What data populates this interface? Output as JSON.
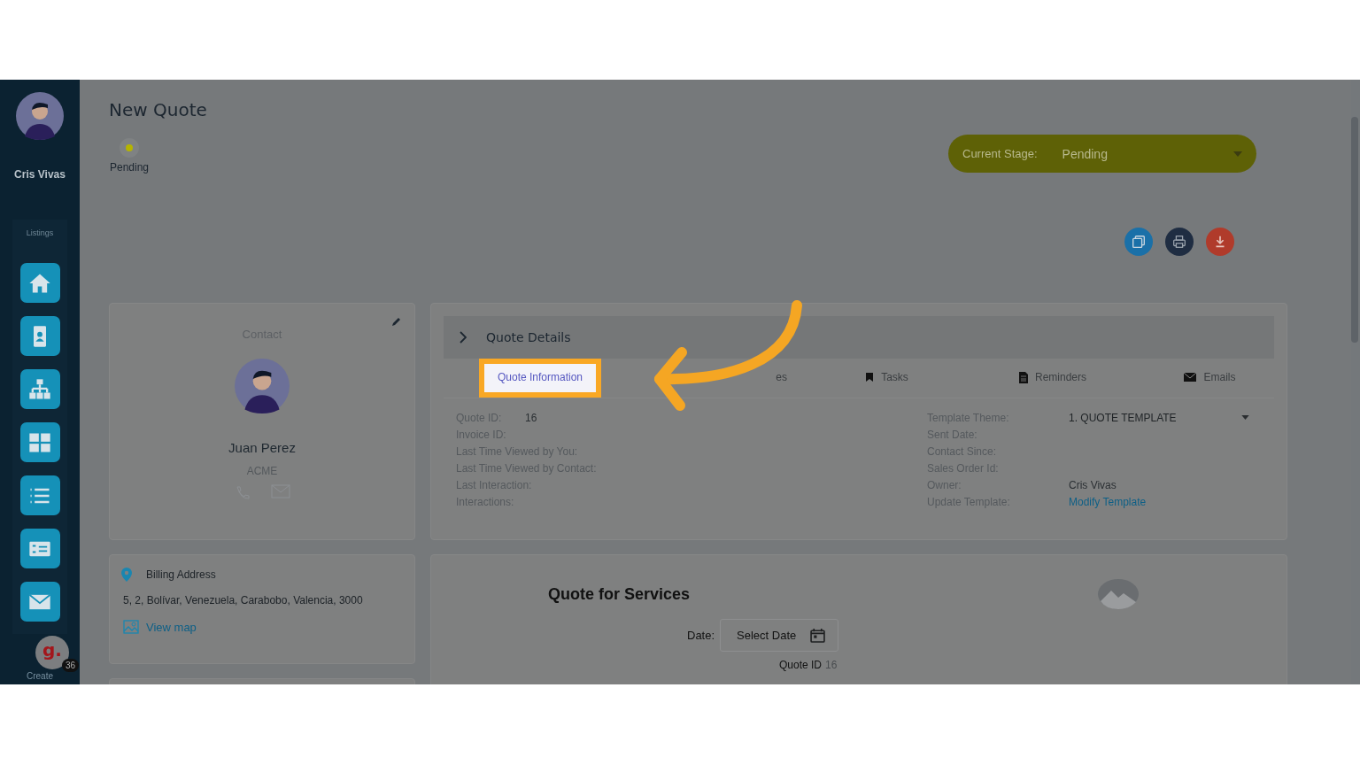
{
  "sidebar": {
    "user_name": "Cris Vivas",
    "section_label": "Listings",
    "items": [
      {
        "kind": "home"
      },
      {
        "kind": "contact"
      },
      {
        "kind": "hierarchy"
      },
      {
        "kind": "grid"
      },
      {
        "kind": "list"
      },
      {
        "kind": "invoice"
      },
      {
        "kind": "mail"
      }
    ],
    "footer_label": "Create",
    "widget": {
      "logo": "g.",
      "count": "36"
    }
  },
  "page": {
    "title": "New Quote",
    "status": {
      "label": "Pending",
      "color": "#b5b400"
    }
  },
  "stage": {
    "label": "Current Stage:",
    "value": "Pending"
  },
  "actions": [
    {
      "kind": "copy",
      "color": "#1a70a8"
    },
    {
      "kind": "print",
      "color": "#1f2d42"
    },
    {
      "kind": "download",
      "color": "#b03b2b"
    }
  ],
  "contact": {
    "heading": "Contact",
    "name": "Juan Perez",
    "company": "ACME"
  },
  "billing": {
    "title": "Billing Address",
    "address": "5, 2, Bolívar, Venezuela, Carabobo, Valencia, 3000",
    "link": "View map"
  },
  "quote_details": {
    "title": "Quote Details",
    "tabs": [
      {
        "label": "Quote Information",
        "kind": "info",
        "selected": true
      },
      {
        "label": "es",
        "kind": "notes",
        "selected": false
      },
      {
        "label": "Tasks",
        "kind": "tasks",
        "selected": false
      },
      {
        "label": "Reminders",
        "kind": "reminders",
        "selected": false
      },
      {
        "label": "Emails",
        "kind": "emails",
        "selected": false
      }
    ],
    "left_fields": [
      {
        "label": "Quote ID:",
        "value": "16"
      },
      {
        "label": "Invoice ID:"
      },
      {
        "label": "Last Time Viewed by You:"
      },
      {
        "label": "Last Time Viewed by Contact:"
      },
      {
        "label": "Last Interaction:"
      },
      {
        "label": "Interactions:"
      }
    ],
    "right_fields": [
      {
        "label": "Template Theme:",
        "value": "1. QUOTE TEMPLATE",
        "kind": "select"
      },
      {
        "label": "Sent Date:"
      },
      {
        "label": "Contact Since:"
      },
      {
        "label": "Sales Order Id:"
      },
      {
        "label": "Owner:",
        "value": "Cris Vivas",
        "kind": "text"
      },
      {
        "label": "Update Template:",
        "value": "Modify Template",
        "kind": "link"
      }
    ]
  },
  "services": {
    "title": "Quote for Services",
    "date_label": "Date:",
    "date_button": "Select Date",
    "quote_id_label": "Quote ID",
    "quote_id": "16"
  }
}
